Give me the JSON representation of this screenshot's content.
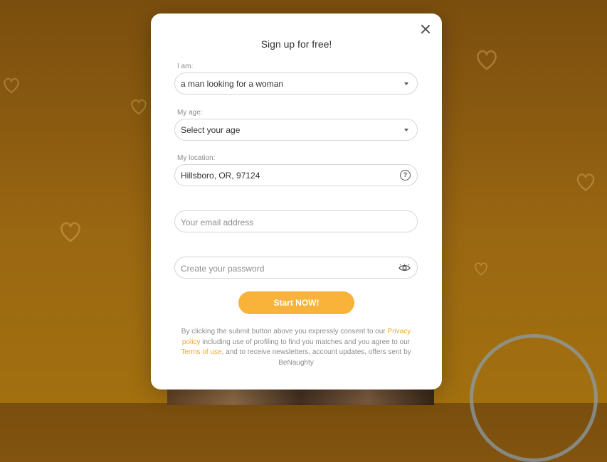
{
  "modal": {
    "title": "Sign up for free!",
    "close_icon": "close-icon"
  },
  "fields": {
    "iam": {
      "label": "I am:",
      "value": "a man looking for a woman",
      "icon": "chevron-down-icon"
    },
    "age": {
      "label": "My age:",
      "placeholder": "Select your age",
      "icon": "chevron-down-icon"
    },
    "location": {
      "label": "My location:",
      "value": "Hillsboro, OR, 97124",
      "icon": "help-icon",
      "icon_glyph": "?"
    },
    "email": {
      "placeholder": "Your email address"
    },
    "password": {
      "placeholder": "Create your password",
      "icon": "eye-icon"
    }
  },
  "cta": {
    "label": "Start NOW!"
  },
  "legal": {
    "part1": "By clicking the submit button above you expressly consent to our",
    "privacy_link": "Privacy policy",
    "part2": "including use of profiling to find you matches and you agree to our",
    "terms_link": "Terms of use",
    "part3": ", and to receive newsletters, account updates, offers sent by BeNaughty"
  },
  "colors": {
    "accent": "#f9b23a",
    "link": "#f3a530",
    "background": "#8a5a10"
  }
}
